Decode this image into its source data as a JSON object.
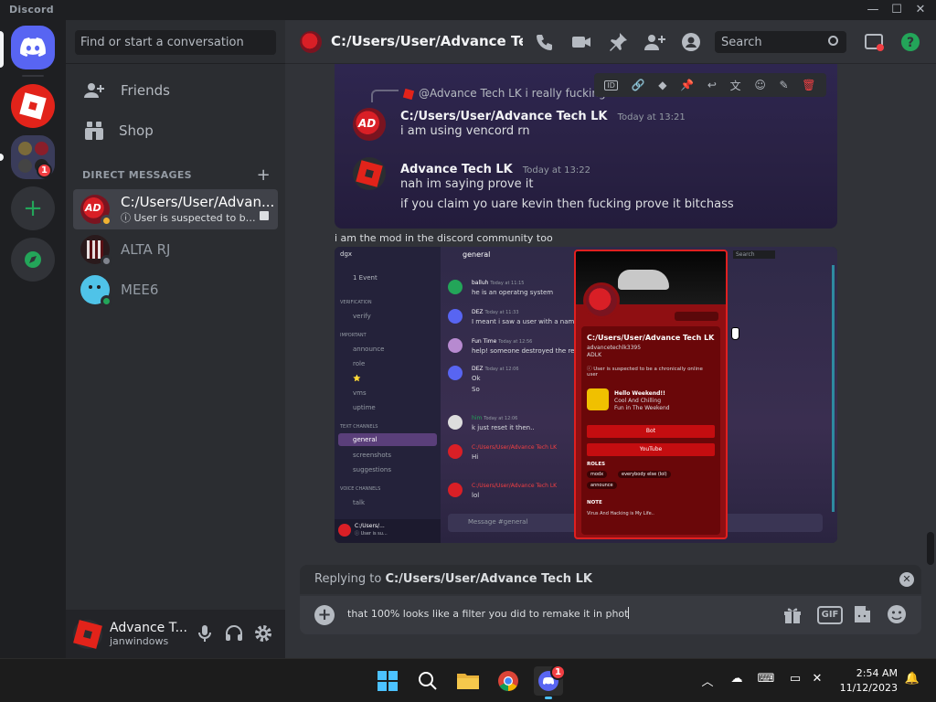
{
  "window": {
    "app_title": "Discord",
    "controls": {
      "minimize": "—",
      "maximize": "☐",
      "close": "✕"
    }
  },
  "servers": {
    "badge_count": "1"
  },
  "sidebar": {
    "search_placeholder": "Find or start a conversation",
    "nav": [
      {
        "label": "Friends",
        "icon": "friends-icon"
      },
      {
        "label": "Shop",
        "icon": "shop-icon"
      }
    ],
    "dm_header": "DIRECT MESSAGES",
    "dms": [
      {
        "name": "C:/Users/User/Advan...",
        "status": "ⓘ User is suspected to be...",
        "active": true
      },
      {
        "name": "ALTA RJ",
        "status": ""
      },
      {
        "name": "MEE6",
        "status": ""
      }
    ]
  },
  "user_panel": {
    "name": "Advance T...",
    "tag": "janwindows"
  },
  "topbar": {
    "title": "C:/Users/User/Advance Tech L",
    "search_placeholder": "Search"
  },
  "messages": {
    "replied_preview": "@Advance Tech LK i really fucking do",
    "first": {
      "author": "C:/Users/User/Advance Tech LK",
      "time": "Today at 13:21",
      "lines": [
        "i am using vencord rn"
      ]
    },
    "second": {
      "author": "Advance Tech LK",
      "time": "Today at 13:22",
      "lines": [
        "nah im saying prove it",
        "if you claim yo uare kevin then fucking prove it bitchass"
      ]
    },
    "caption": "i am the mod in the discord community too"
  },
  "embedded_screenshot": {
    "server_name": "dgx",
    "event": "1 Event",
    "channel_header": "general",
    "search": "Search",
    "cats": {
      "verification": "VERIFICATION",
      "important": "IMPORTANT",
      "text": "TEXT CHANNELS",
      "voice": "VOICE CHANNELS"
    },
    "channels": [
      "verify",
      "announce",
      "role",
      "⭐",
      "vms",
      "uptime",
      "general",
      "screenshots",
      "suggestions",
      "talk"
    ],
    "chat": [
      {
        "author": "balluh",
        "time": "Today at 11:15",
        "text": "he is an operatng system"
      },
      {
        "author": "DEZ",
        "time": "Today at 11:33",
        "text": "I meant i saw a user with a name"
      },
      {
        "author": "Fun Time",
        "time": "Today at 12:56",
        "text": "help! someone destroyed the reac"
      },
      {
        "author": "DEZ",
        "time": "Today at 12:06",
        "text": "Ok"
      },
      {
        "author": "",
        "time": "",
        "text": "So"
      },
      {
        "author": "him",
        "time": "Today at 12:06",
        "text": "k just reset it then.."
      },
      {
        "author": "C:/Users/User/Advance Tech LK",
        "time": "",
        "text": "Hi"
      },
      {
        "author": "C:/Users/User/Advance Tech LK",
        "time": "",
        "text": "lol"
      }
    ],
    "mini_user": "C:/Users/...",
    "mini_status": "ⓘ User is su...",
    "composer_placeholder": "Message #general",
    "profile": {
      "name": "C:/Users/User/Advance Tech LK",
      "username": "advancetechlk3395",
      "short": "ADLK",
      "status": "ⓘ User is suspected to be a chronically online user",
      "activity_title": "Hello Weekend!!",
      "activity_line1": "Cool And Chilling",
      "activity_line2": "Fun in The Weekend",
      "btn1": "Bot",
      "btn2": "YouTube",
      "roles_hdr": "ROLES",
      "roles": [
        "modx",
        "everybody else (lol)",
        "announce"
      ],
      "note_hdr": "NOTE",
      "note": "Virus And Hacking is My Life.."
    }
  },
  "composer": {
    "reply_prefix": "Replying to",
    "reply_target": "C:/Users/User/Advance Tech LK",
    "text": "that 100% looks like a filter you did to remake it in phot",
    "gif": "GIF"
  },
  "taskbar": {
    "time": "2:54 AM",
    "date": "11/12/2023",
    "discord_badge": "1"
  },
  "colors": {
    "blurple": "#5865f2",
    "green": "#23a559",
    "red": "#f23f43",
    "roblox_red": "#e2231a",
    "profile_red": "#8f0f12"
  }
}
